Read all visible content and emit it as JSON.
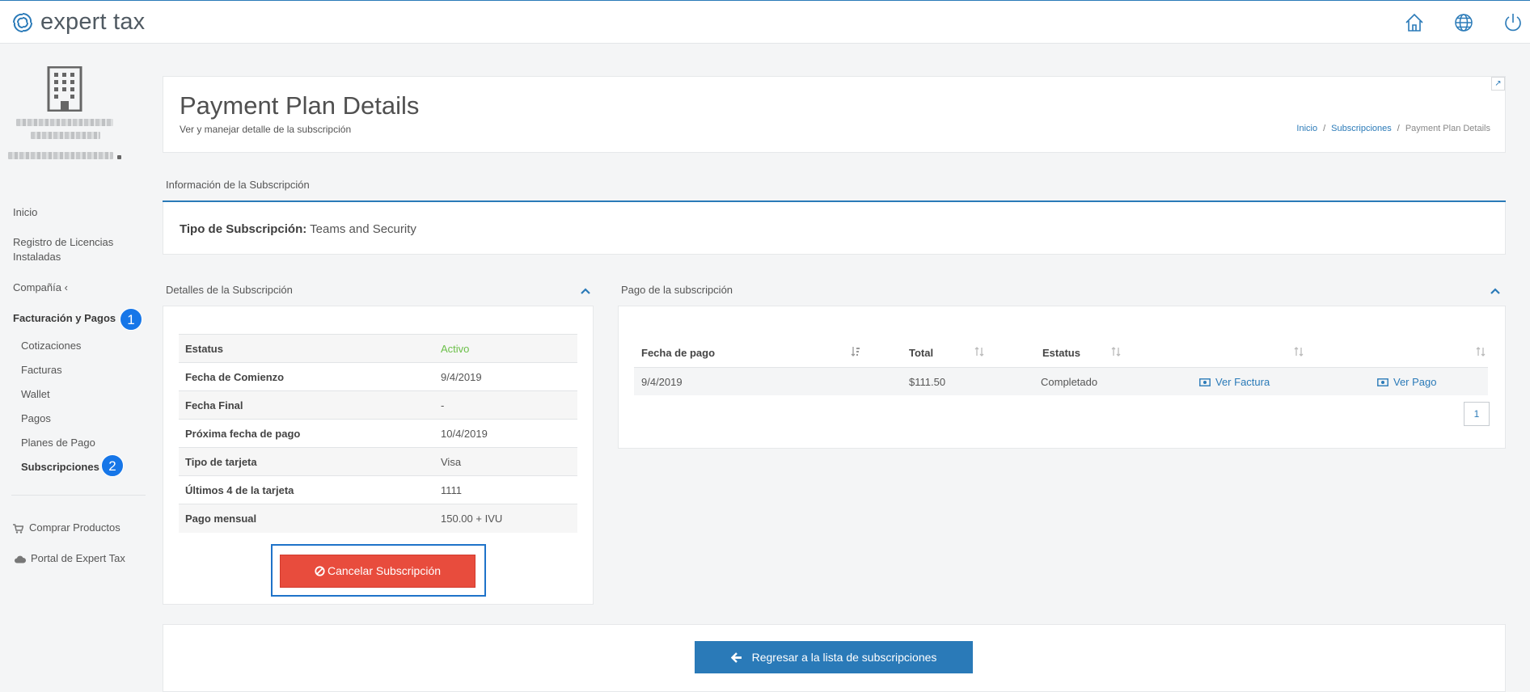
{
  "brand": {
    "name": "expert tax"
  },
  "header_icons": [
    "home-icon",
    "globe-icon",
    "power-icon"
  ],
  "sidebar": {
    "items": [
      {
        "label": "Inicio"
      },
      {
        "label": "Registro de Licencias Instaladas"
      },
      {
        "label": "Compañía ‹"
      },
      {
        "label": "Facturación y Pagos",
        "badge": "1"
      },
      {
        "label": "Cotizaciones"
      },
      {
        "label": "Facturas"
      },
      {
        "label": "Wallet"
      },
      {
        "label": "Pagos"
      },
      {
        "label": "Planes de Pago"
      },
      {
        "label": "Subscripciones",
        "badge": "2"
      },
      {
        "label": "Comprar Productos"
      },
      {
        "label": "Portal de Expert Tax"
      }
    ]
  },
  "page": {
    "title": "Payment Plan Details",
    "subtitle": "Ver y manejar detalle de la subscripción",
    "breadcrumb": [
      "Inicio",
      "Subscripciones",
      "Payment Plan Details"
    ],
    "separator": "/"
  },
  "info": {
    "section_label": "Información de la Subscripción",
    "type_label": "Tipo de Subscripción:",
    "type_value": "Teams and Security"
  },
  "details": {
    "section_label": "Detalles de la Subscripción",
    "rows": [
      {
        "k": "Estatus",
        "v": "Activo"
      },
      {
        "k": "Fecha de Comienzo",
        "v": "9/4/2019"
      },
      {
        "k": "Fecha Final",
        "v": "-"
      },
      {
        "k": "Próxima fecha de pago",
        "v": "10/4/2019"
      },
      {
        "k": "Tipo de tarjeta",
        "v": "Visa"
      },
      {
        "k": "Últimos 4 de la tarjeta",
        "v": "1111"
      },
      {
        "k": "Pago mensual",
        "v": "150.00 + IVU"
      }
    ],
    "cancel_label": "Cancelar Subscripción"
  },
  "payments": {
    "section_label": "Pago de la subscripción",
    "columns": [
      "Fecha de pago",
      "Total",
      "Estatus",
      "",
      ""
    ],
    "rows": [
      {
        "date": "9/4/2019",
        "total": "$111.50",
        "status": "Completado",
        "link1": "Ver Factura",
        "link2": "Ver Pago"
      }
    ],
    "page": "1"
  },
  "footer": {
    "back_label": "Regresar a la lista de subscripciones"
  },
  "colors": {
    "accent": "#2a7ab8",
    "danger": "#e84c3d",
    "badge": "#1676e8",
    "active": "#6cc04a"
  }
}
